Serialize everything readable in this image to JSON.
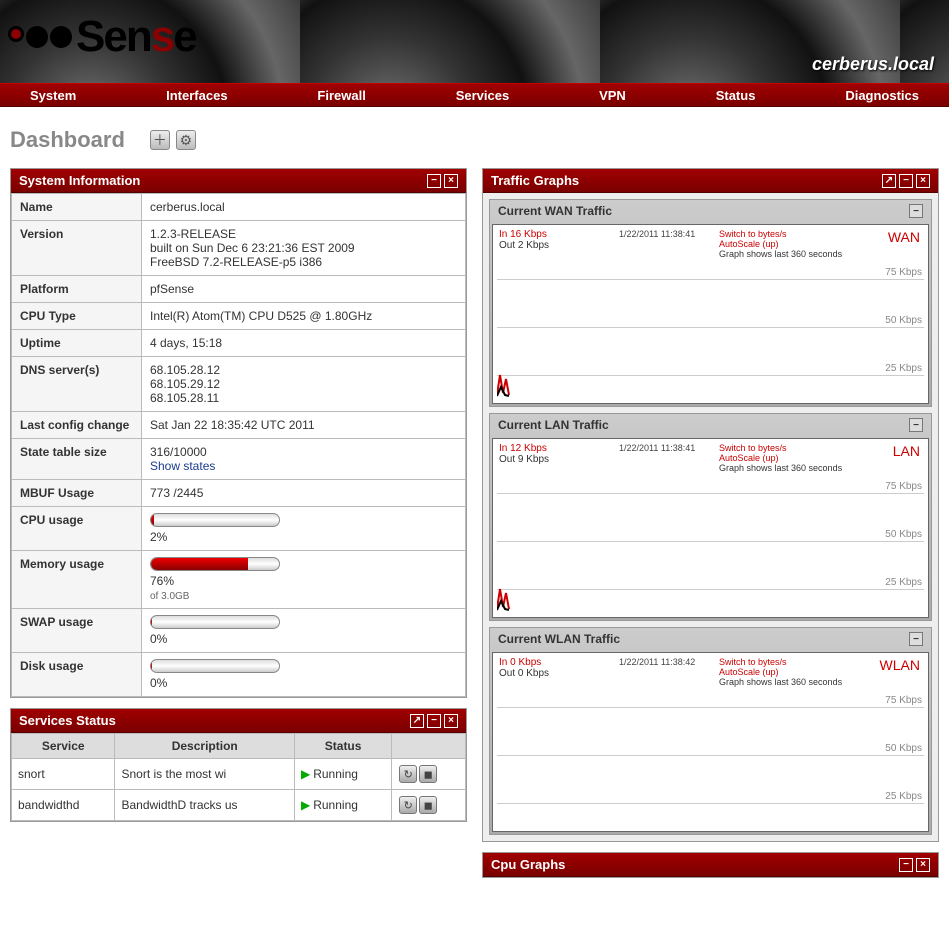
{
  "brand": {
    "text_part1": "Sen",
    "text_s": "s",
    "text_part2": "e"
  },
  "hostname": "cerberus.local",
  "nav": [
    "System",
    "Interfaces",
    "Firewall",
    "Services",
    "VPN",
    "Status",
    "Diagnostics"
  ],
  "page_title": "Dashboard",
  "sysinfo": {
    "title": "System Information",
    "rows": {
      "name_label": "Name",
      "name_val": "cerberus.local",
      "version_label": "Version",
      "version_line1": "1.2.3-RELEASE",
      "version_line2": "built on Sun Dec 6 23:21:36 EST 2009",
      "version_line3": "FreeBSD 7.2-RELEASE-p5 i386",
      "platform_label": "Platform",
      "platform_val": "pfSense",
      "cpu_label": "CPU Type",
      "cpu_val": "Intel(R) Atom(TM) CPU D525 @ 1.80GHz",
      "uptime_label": "Uptime",
      "uptime_val": "4 days, 15:18",
      "dns_label": "DNS server(s)",
      "dns1": "68.105.28.12",
      "dns2": "68.105.29.12",
      "dns3": "68.105.28.11",
      "lastcfg_label": "Last config change",
      "lastcfg_val": "Sat Jan 22 18:35:42 UTC 2011",
      "state_label": "State table size",
      "state_val": "316/10000",
      "state_link": "Show states",
      "mbuf_label": "MBUF Usage",
      "mbuf_val": "773 /2445",
      "cpuu_label": "CPU usage",
      "cpuu_pct": "2%",
      "cpuu_bar": 2,
      "mem_label": "Memory usage",
      "mem_pct": "76%",
      "mem_of": "of 3.0GB",
      "mem_bar": 76,
      "swap_label": "SWAP usage",
      "swap_pct": "0%",
      "swap_bar": 0,
      "disk_label": "Disk usage",
      "disk_pct": "0%",
      "disk_bar": 0
    }
  },
  "services": {
    "title": "Services Status",
    "cols": {
      "svc": "Service",
      "desc": "Description",
      "status": "Status"
    },
    "running": "Running",
    "rows": [
      {
        "name": "snort",
        "desc": "Snort is the most wi"
      },
      {
        "name": "bandwidthd",
        "desc": "BandwidthD tracks us"
      }
    ]
  },
  "traffic": {
    "title": "Traffic Graphs",
    "scale_labels": {
      "y75": "75 Kbps",
      "y50": "50 Kbps",
      "y25": "25 Kbps"
    },
    "meta": {
      "switch": "Switch to bytes/s",
      "autoscale": "AutoScale (up)",
      "note": "Graph shows last 360 seconds"
    },
    "graphs": [
      {
        "hdr": "Current WAN Traffic",
        "iface": "WAN",
        "in": "In    16 Kbps",
        "out": "Out  2 Kbps",
        "ts": "1/22/2011 11:38:41"
      },
      {
        "hdr": "Current LAN Traffic",
        "iface": "LAN",
        "in": "In    12 Kbps",
        "out": "Out  9 Kbps",
        "ts": "1/22/2011 11:38:41"
      },
      {
        "hdr": "Current WLAN Traffic",
        "iface": "WLAN",
        "in": "In    0 Kbps",
        "out": "Out  0 Kbps",
        "ts": "1/22/2011 11:38:42"
      }
    ]
  },
  "cpugraphs": {
    "title": "Cpu Graphs"
  }
}
